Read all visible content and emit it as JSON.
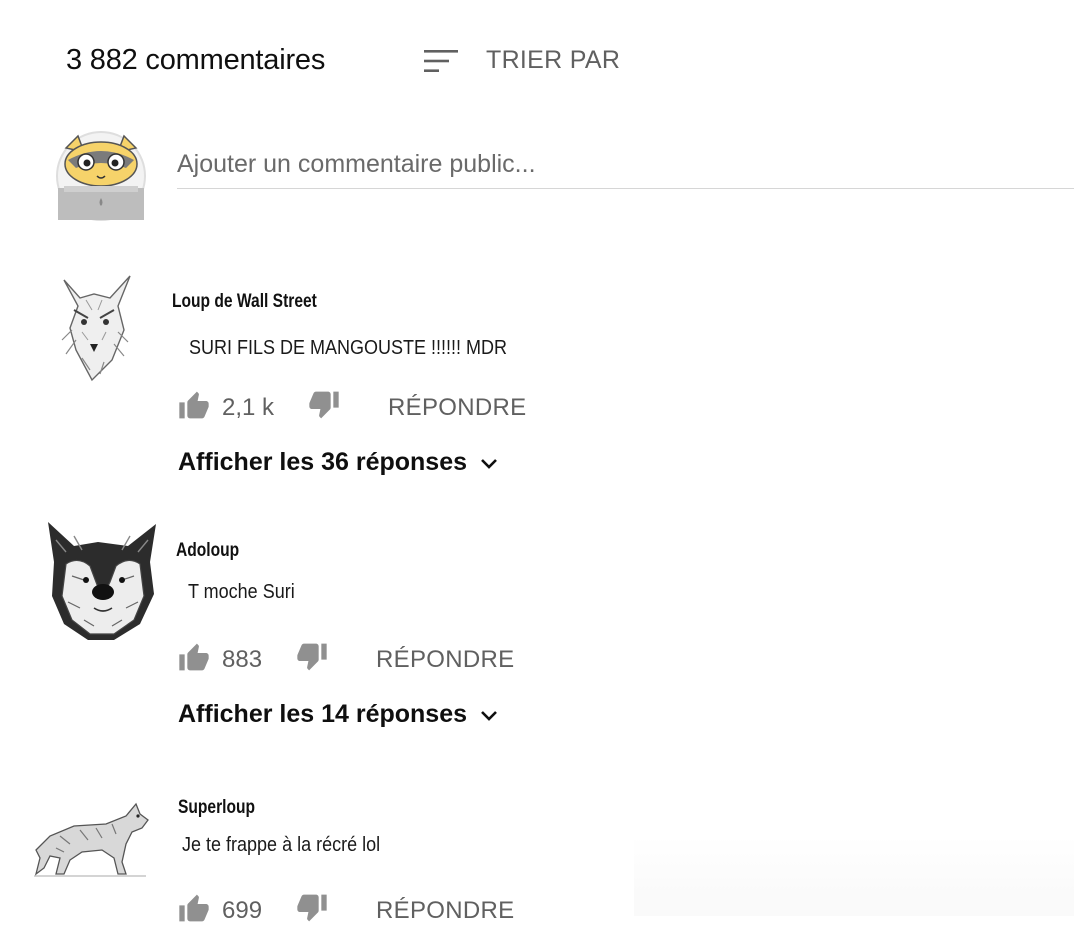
{
  "header": {
    "count_label": "3 882 commentaires",
    "sort_label": "TRIER PAR",
    "sort_icon": "sort-icon"
  },
  "add_comment": {
    "placeholder": "Ajouter un commentaire public..."
  },
  "comments": [
    {
      "author": "Loup de Wall Street",
      "text": "SURI FILS DE MANGOUSTE !!!!!! MDR",
      "likes": "2,1 k",
      "reply_label": "RÉPONDRE",
      "replies_label": "Afficher les 36 réponses"
    },
    {
      "author": "Adoloup",
      "text": "T moche Suri",
      "likes": "883",
      "reply_label": "RÉPONDRE",
      "replies_label": "Afficher les 14 réponses"
    },
    {
      "author": "Superloup",
      "text": "Je te frappe à la récré lol",
      "likes": "699",
      "reply_label": "RÉPONDRE"
    }
  ],
  "colors": {
    "text_primary": "#0f0f0f",
    "text_secondary": "#606060",
    "divider": "#d6d6d6"
  }
}
